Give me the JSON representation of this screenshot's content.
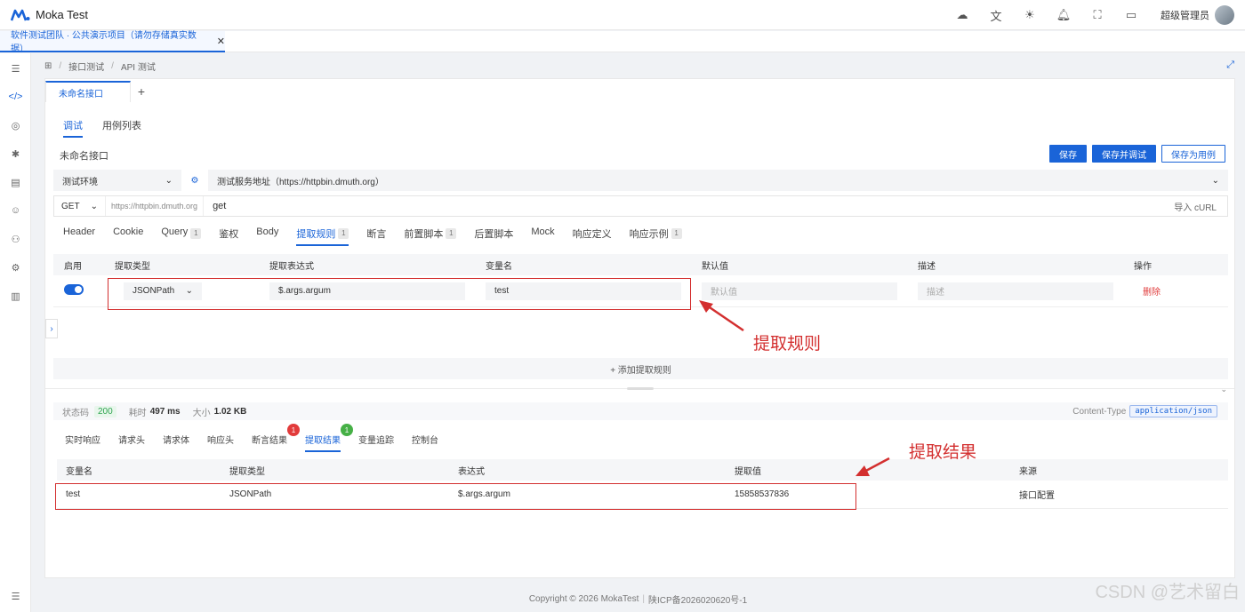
{
  "app": {
    "title": "Moka Test",
    "admin": "超级管理员"
  },
  "project_tab": {
    "label": "软件测试团队 · 公共演示项目（请勿存储真实数据）",
    "close": "✕"
  },
  "breadcrumb": [
    "接口测试",
    "API 测试"
  ],
  "api_tab": {
    "label": "未命名接口",
    "add": "+"
  },
  "subtabs": [
    "调试",
    "用例列表"
  ],
  "api_name": "未命名接口",
  "buttons": {
    "save": "保存",
    "save_debug": "保存并调试",
    "save_case": "保存为用例"
  },
  "env": {
    "environment": "测试环境",
    "server": "测试服务地址（https://httpbin.dmuth.org）"
  },
  "request": {
    "method": "GET",
    "base_url": "https://httpbin.dmuth.org",
    "path": "get",
    "import_curl": "导入 cURL"
  },
  "req_tabs": [
    {
      "label": "Header",
      "badge": ""
    },
    {
      "label": "Cookie",
      "badge": ""
    },
    {
      "label": "Query",
      "badge": "1"
    },
    {
      "label": "鉴权",
      "badge": ""
    },
    {
      "label": "Body",
      "badge": ""
    },
    {
      "label": "提取规则",
      "badge": "1"
    },
    {
      "label": "断言",
      "badge": ""
    },
    {
      "label": "前置脚本",
      "badge": "1"
    },
    {
      "label": "后置脚本",
      "badge": ""
    },
    {
      "label": "Mock",
      "badge": ""
    },
    {
      "label": "响应定义",
      "badge": ""
    },
    {
      "label": "响应示例",
      "badge": "1"
    }
  ],
  "rules_table": {
    "headers": [
      "启用",
      "提取类型",
      "提取表达式",
      "变量名",
      "默认值",
      "描述",
      "操作"
    ],
    "row": {
      "type": "JSONPath",
      "expression": "$.args.argum",
      "variable": "test",
      "default_placeholder": "默认值",
      "desc_placeholder": "描述",
      "delete": "删除"
    },
    "add_label": "+ 添加提取规则"
  },
  "response_meta": {
    "status_label": "状态码",
    "status": "200",
    "time_label": "耗时",
    "time": "497 ms",
    "size_label": "大小",
    "size": "1.02 KB",
    "ctype_label": "Content-Type",
    "ctype": "application/json"
  },
  "resp_tabs": [
    {
      "label": "实时响应",
      "badge": ""
    },
    {
      "label": "请求头",
      "badge": ""
    },
    {
      "label": "请求体",
      "badge": ""
    },
    {
      "label": "响应头",
      "badge": ""
    },
    {
      "label": "断言结果",
      "badge": "1"
    },
    {
      "label": "提取结果",
      "badge": "1"
    },
    {
      "label": "变量追踪",
      "badge": ""
    },
    {
      "label": "控制台",
      "badge": ""
    }
  ],
  "result_table": {
    "headers": [
      "变量名",
      "提取类型",
      "表达式",
      "提取值",
      "来源"
    ],
    "row": [
      "test",
      "JSONPath",
      "$.args.argum",
      "15858537836",
      "接口配置"
    ]
  },
  "footer": {
    "copyright": "Copyright © 2026 MokaTest",
    "icp": "陕ICP备2026020620号-1"
  },
  "annotations": {
    "rule": "提取规则",
    "result": "提取结果"
  },
  "watermark_corner": "CSDN @艺术留白",
  "colors": {
    "primary": "#1a64d8",
    "danger": "#e03c3c",
    "annotation": "#d32f2f"
  }
}
